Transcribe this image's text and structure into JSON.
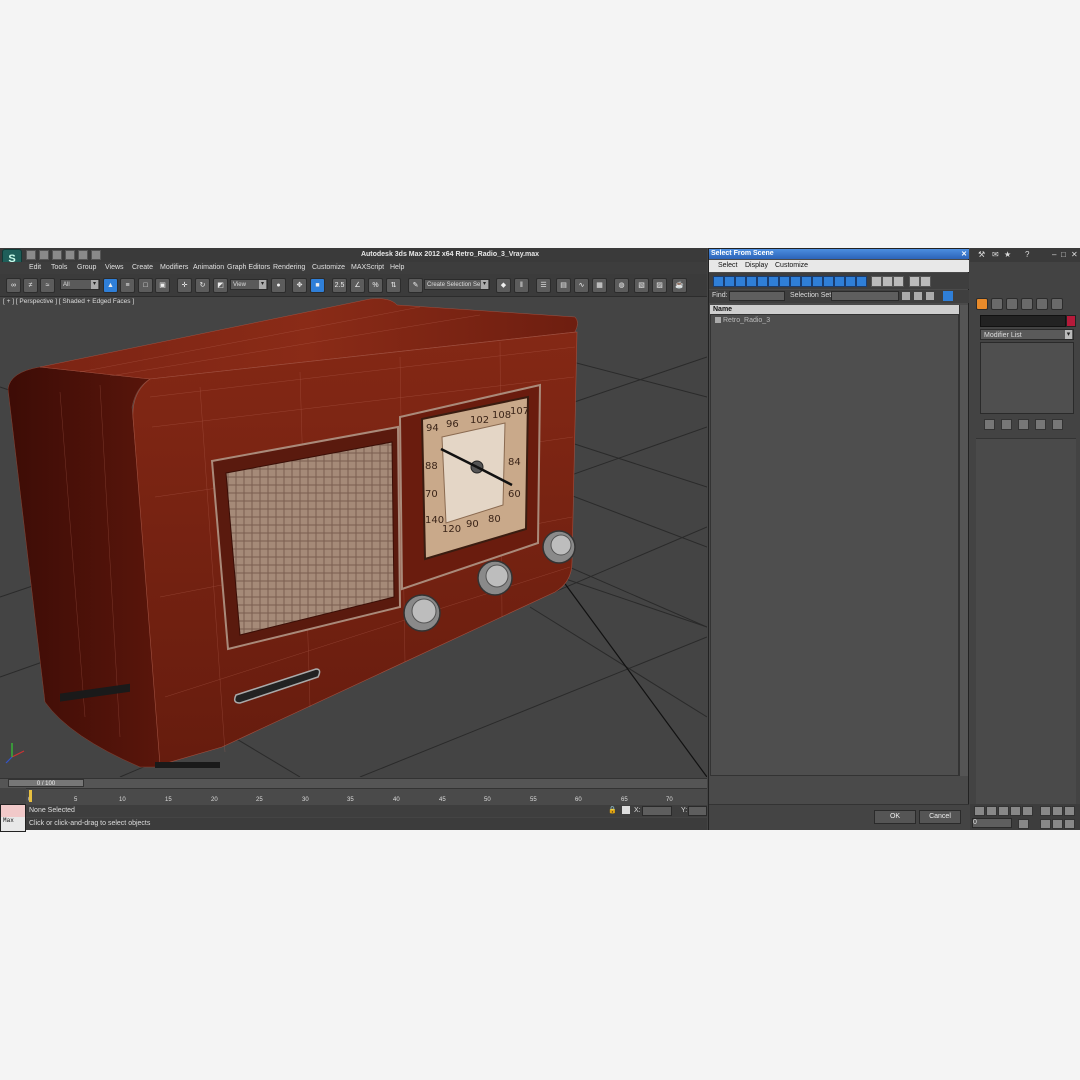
{
  "window": {
    "title": "Autodesk 3ds Max  2012 x64    Retro_Radio_3_Vray.max",
    "app_logo": "3ds-max-logo"
  },
  "menu": [
    "Edit",
    "Tools",
    "Group",
    "Views",
    "Create",
    "Modifiers",
    "Animation",
    "Graph Editors",
    "Rendering",
    "Customize",
    "MAXScript",
    "Help"
  ],
  "toolbar": {
    "filter_value": "All",
    "refcoord_value": "View",
    "selection_set_placeholder": "Create Selection Se",
    "snap_label": "2.5",
    "percent_label": "%"
  },
  "viewport": {
    "label": "[ + ] [ Perspective ] [ Shaded + Edged Faces ]",
    "dial_numbers": [
      "94",
      "96",
      "102",
      "108",
      "107",
      "88",
      "84",
      "70",
      "60",
      "140",
      "120",
      "90",
      "80",
      "70"
    ]
  },
  "timeline": {
    "frame_counter": "0 / 100",
    "ticks": [
      "0",
      "5",
      "10",
      "15",
      "20",
      "25",
      "30",
      "35",
      "40",
      "45",
      "50",
      "55",
      "60",
      "65",
      "70"
    ]
  },
  "status": {
    "selection": "None Selected",
    "prompt": "Click or click-and-drag to select objects",
    "x_label": "X:",
    "y_label": "Y:",
    "listener_label": "Max"
  },
  "select_dialog": {
    "title": "Select From Scene",
    "menu": [
      "Select",
      "Display",
      "Customize"
    ],
    "find_label": "Find:",
    "selection_set_label": "Selection Set:",
    "column_header": "Name",
    "items": [
      "Retro_Radio_3"
    ],
    "ok_label": "OK",
    "cancel_label": "Cancel"
  },
  "command_panel": {
    "modifier_list": "Modifier List",
    "frame_field": "0"
  },
  "colors": {
    "accent": "#2f7fd8",
    "object_color": "#b51a3a",
    "wood": "#7a1f12"
  }
}
